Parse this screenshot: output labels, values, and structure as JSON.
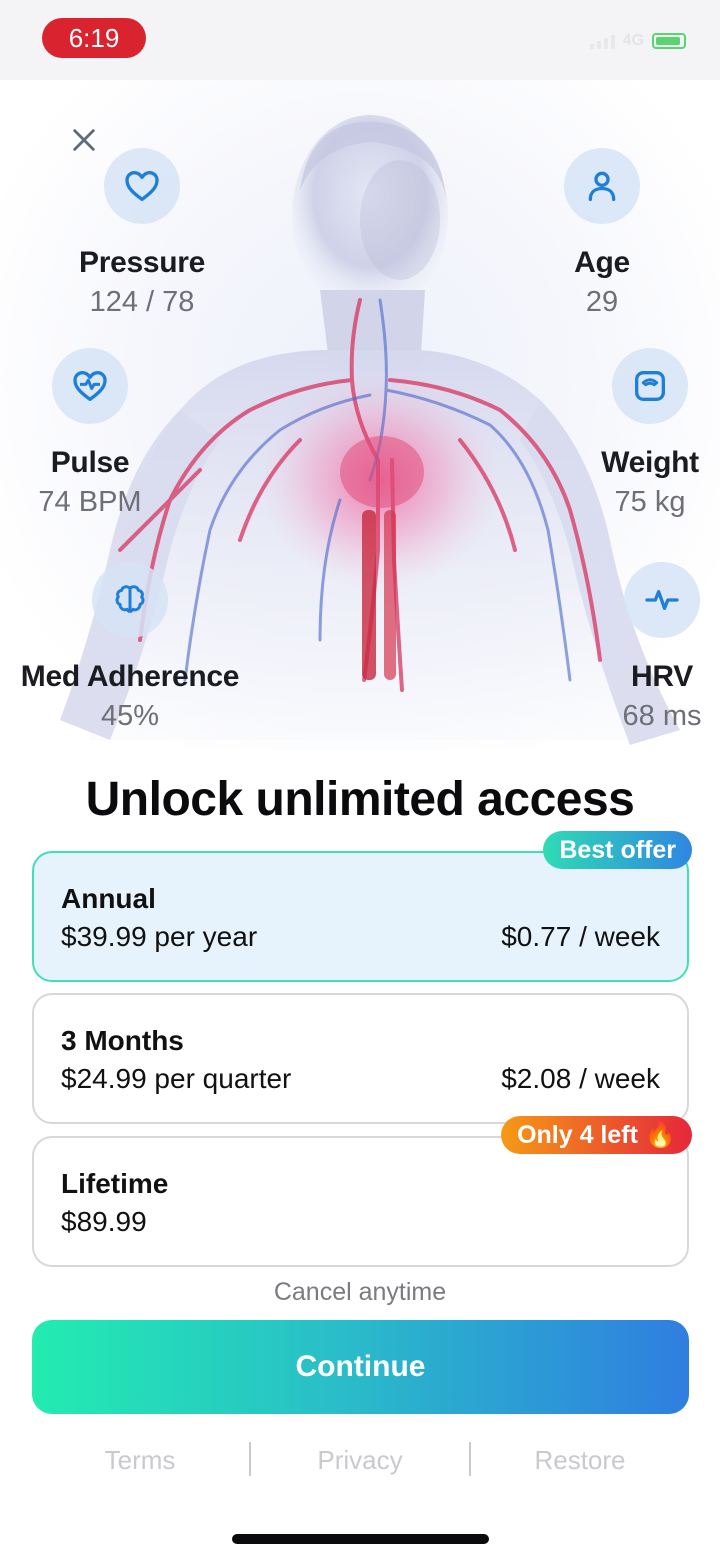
{
  "status_bar": {
    "time": "6:19",
    "network": "4G",
    "colors": {
      "time_pill": "#d9242f",
      "battery": "#3fcf5a"
    }
  },
  "hero": {
    "close_icon": "close-icon",
    "metrics": [
      {
        "icon": "heart-icon",
        "label": "Pressure",
        "value": "124 / 78"
      },
      {
        "icon": "person-icon",
        "label": "Age",
        "value": "29"
      },
      {
        "icon": "heart-pulse-icon",
        "label": "Pulse",
        "value": "74 BPM"
      },
      {
        "icon": "scale-icon",
        "label": "Weight",
        "value": "75 kg"
      },
      {
        "icon": "brain-icon",
        "label": "Med Adherence",
        "value": "45%"
      },
      {
        "icon": "activity-icon",
        "label": "HRV",
        "value": "68 ms"
      }
    ]
  },
  "headline": "Unlock unlimited access",
  "plans": [
    {
      "name": "Annual",
      "price": "$39.99 per year",
      "weekly": "$0.77 / week",
      "selected": true,
      "badge": "Best offer"
    },
    {
      "name": "3 Months",
      "price": "$24.99 per quarter",
      "weekly": "$2.08 / week",
      "selected": false
    },
    {
      "name": "Lifetime",
      "price": "$89.99",
      "weekly": "",
      "selected": false,
      "badge": "Only 4 left 🔥"
    }
  ],
  "cancel_text": "Cancel anytime",
  "continue_label": "Continue",
  "footer": {
    "terms": "Terms",
    "privacy": "Privacy",
    "restore": "Restore"
  },
  "colors": {
    "accent_start": "#22ecb0",
    "accent_end": "#2f7ee0",
    "selected_border": "#3fe0b6",
    "selected_bg": "#e7f3fc",
    "icon_color": "#1e7fd6"
  }
}
